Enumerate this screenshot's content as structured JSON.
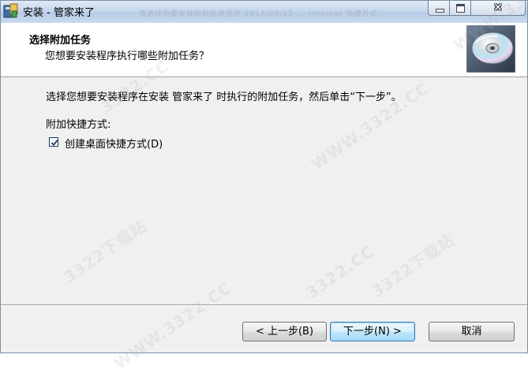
{
  "window": {
    "title": "安装 - 管家来了",
    "title_ghost": "请选择你要安装的新应用程序   2017/08/15 ...   Internet 快捷方式"
  },
  "header": {
    "title": "选择附加任务",
    "subtitle": "您想要安装程序执行哪些附加任务？"
  },
  "content": {
    "intro": "选择您想要安装程序在安装 管家来了 时执行的附加任务，然后单击“下一步”。",
    "group_label": "附加快捷方式:",
    "checkbox": {
      "label": "创建桌面快捷方式(D)",
      "checked": true
    }
  },
  "buttons": {
    "back": "< 上一步(B)",
    "next": "下一步(N) >",
    "cancel": "取消"
  },
  "watermarks": [
    "3322.CC",
    "WWW.3322.CC",
    "3322下载站",
    "3322.CC",
    "WWW.3322.CC",
    "3322下载站",
    "WWW.3322.CC"
  ],
  "colors": {
    "header_bg": "#ffffff",
    "body_bg": "#f0f0f0",
    "accent": "#3c7fb1"
  }
}
